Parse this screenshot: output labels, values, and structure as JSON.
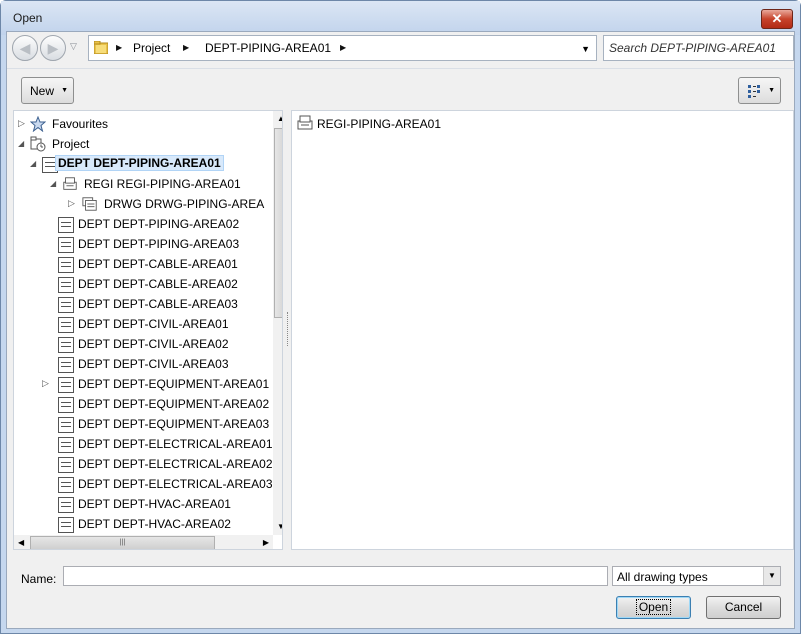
{
  "window": {
    "title": "Open",
    "close_label": "✕"
  },
  "nav": {
    "breadcrumbs": [
      "Project",
      "DEPT-PIPING-AREA01"
    ],
    "search_placeholder": "Search DEPT-PIPING-AREA01"
  },
  "toolbar": {
    "new_label": "New"
  },
  "tree": {
    "items": [
      {
        "label": "Favourites",
        "icon": "star-icon",
        "expander": "collapsed",
        "level": 0
      },
      {
        "label": "Project",
        "icon": "project-icon",
        "expander": "expanded",
        "level": 0
      },
      {
        "label": "DEPT DEPT-PIPING-AREA01",
        "icon": "dept-icon",
        "expander": "expanded",
        "level": 1,
        "selected": true
      },
      {
        "label": "REGI REGI-PIPING-AREA01",
        "icon": "regi-icon",
        "expander": "expanded",
        "level": 2
      },
      {
        "label": "DRWG DRWG-PIPING-AREA",
        "icon": "drwg-icon",
        "expander": "collapsed",
        "level": 3
      },
      {
        "label": "DEPT DEPT-PIPING-AREA02",
        "icon": "dept-icon",
        "expander": "none",
        "level": 1
      },
      {
        "label": "DEPT DEPT-PIPING-AREA03",
        "icon": "dept-icon",
        "expander": "none",
        "level": 1
      },
      {
        "label": "DEPT DEPT-CABLE-AREA01",
        "icon": "dept-icon",
        "expander": "none",
        "level": 1
      },
      {
        "label": "DEPT DEPT-CABLE-AREA02",
        "icon": "dept-icon",
        "expander": "none",
        "level": 1
      },
      {
        "label": "DEPT DEPT-CABLE-AREA03",
        "icon": "dept-icon",
        "expander": "none",
        "level": 1
      },
      {
        "label": "DEPT DEPT-CIVIL-AREA01",
        "icon": "dept-icon",
        "expander": "none",
        "level": 1
      },
      {
        "label": "DEPT DEPT-CIVIL-AREA02",
        "icon": "dept-icon",
        "expander": "none",
        "level": 1
      },
      {
        "label": "DEPT DEPT-CIVIL-AREA03",
        "icon": "dept-icon",
        "expander": "none",
        "level": 1
      },
      {
        "label": "DEPT DEPT-EQUIPMENT-AREA01",
        "icon": "dept-icon",
        "expander": "collapsed",
        "level": 1
      },
      {
        "label": "DEPT DEPT-EQUIPMENT-AREA02",
        "icon": "dept-icon",
        "expander": "none",
        "level": 1
      },
      {
        "label": "DEPT DEPT-EQUIPMENT-AREA03",
        "icon": "dept-icon",
        "expander": "none",
        "level": 1
      },
      {
        "label": "DEPT DEPT-ELECTRICAL-AREA01",
        "icon": "dept-icon",
        "expander": "none",
        "level": 1
      },
      {
        "label": "DEPT DEPT-ELECTRICAL-AREA02",
        "icon": "dept-icon",
        "expander": "none",
        "level": 1
      },
      {
        "label": "DEPT DEPT-ELECTRICAL-AREA03",
        "icon": "dept-icon",
        "expander": "none",
        "level": 1
      },
      {
        "label": "DEPT DEPT-HVAC-AREA01",
        "icon": "dept-icon",
        "expander": "none",
        "level": 1
      },
      {
        "label": "DEPT DEPT-HVAC-AREA02",
        "icon": "dept-icon",
        "expander": "none",
        "level": 1
      }
    ]
  },
  "file_list": [
    {
      "label": "REGI-PIPING-AREA01",
      "icon": "regi-icon"
    }
  ],
  "footer": {
    "name_label": "Name:",
    "name_value": "",
    "file_type": "All drawing types",
    "open_label": "Open",
    "cancel_label": "Cancel"
  },
  "colors": {
    "selection": "#d8e9fb",
    "titlebar": "#c5d7ee",
    "close": "#c7432b"
  }
}
